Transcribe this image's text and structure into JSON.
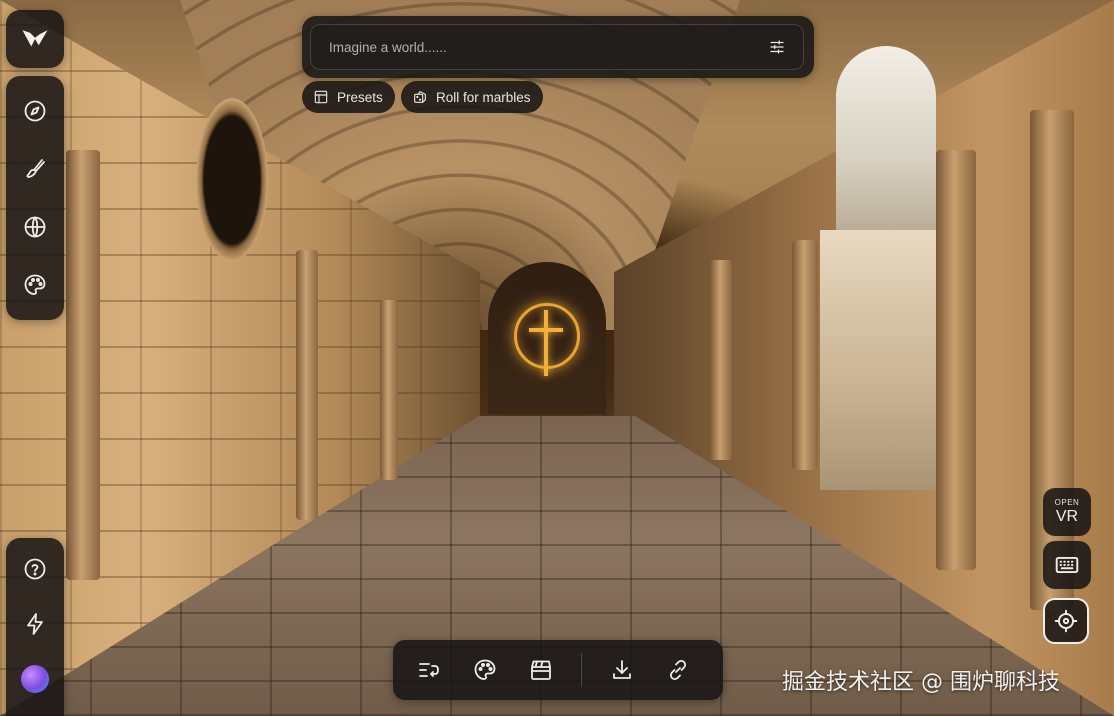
{
  "prompt": {
    "placeholder": "Imagine a world......",
    "value": "",
    "settings_icon": "sliders-icon"
  },
  "chips": [
    {
      "label": "Presets",
      "icon": "layout-icon"
    },
    {
      "label": "Roll for marbles",
      "icon": "dice-icon"
    }
  ],
  "sidebar": {
    "logo_icon": "brand-logo-icon",
    "tools": [
      {
        "name": "explore",
        "icon": "compass-icon"
      },
      {
        "name": "paint",
        "icon": "brush-icon"
      },
      {
        "name": "world",
        "icon": "globe-icon"
      },
      {
        "name": "style",
        "icon": "palette-icon"
      }
    ],
    "bottom": [
      {
        "name": "help",
        "icon": "help-circle-icon"
      },
      {
        "name": "activity",
        "icon": "lightning-icon"
      },
      {
        "name": "profile",
        "icon": "avatar"
      }
    ]
  },
  "bottom_toolbar": [
    {
      "name": "history",
      "icon": "list-undo-icon"
    },
    {
      "name": "style",
      "icon": "palette-icon"
    },
    {
      "name": "scene",
      "icon": "clapperboard-icon"
    },
    {
      "name": "download",
      "icon": "download-icon"
    },
    {
      "name": "share-link",
      "icon": "link-icon"
    }
  ],
  "right_controls": {
    "vr": {
      "top": "OPEN",
      "main": "VR"
    },
    "keyboard_icon": "keyboard-icon",
    "recenter_icon": "crosshair-icon"
  },
  "scene": {
    "accent": "#f2b038"
  },
  "watermark": "掘金技术社区 @ 围炉聊科技"
}
